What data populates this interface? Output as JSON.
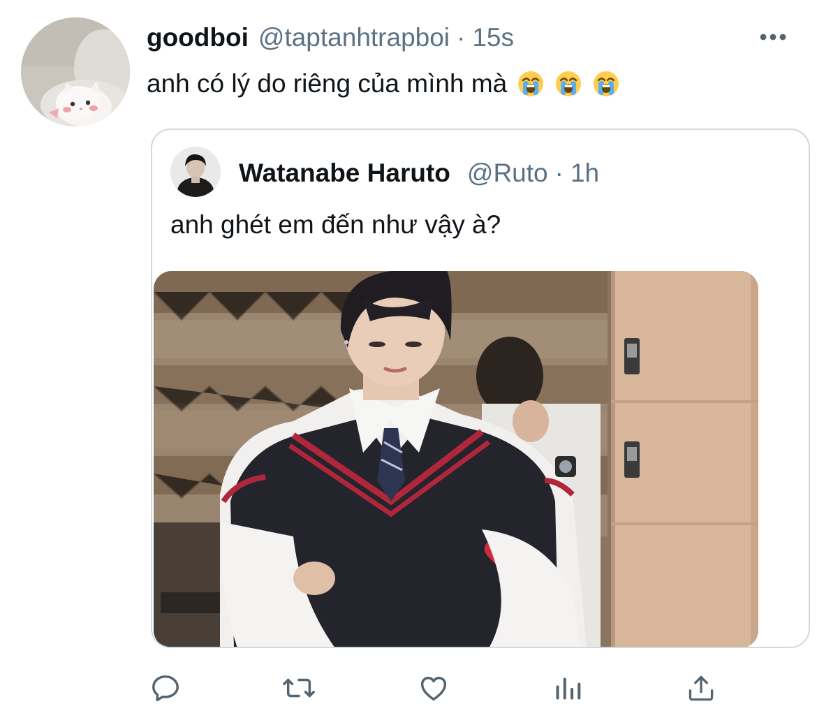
{
  "tweet": {
    "display_name": "goodboi",
    "handle": "@taptanhtrapboi",
    "separator": "·",
    "time": "15s",
    "text": "anh có lý do riêng của mình mà",
    "emojis": [
      "loudly-crying-face",
      "loudly-crying-face",
      "loudly-crying-face"
    ]
  },
  "quoted": {
    "display_name": "Watanabe Haruto",
    "handle": "@Ruto",
    "separator": "·",
    "time": "1h",
    "text": "anh ghét em đến như vậy à?"
  },
  "actions": [
    {
      "icon": "reply-icon"
    },
    {
      "icon": "retweet-icon"
    },
    {
      "icon": "like-icon"
    },
    {
      "icon": "analytics-icon"
    },
    {
      "icon": "share-icon"
    }
  ],
  "colors": {
    "text_primary": "#0f1419",
    "text_secondary": "#5b7083",
    "border": "#cfd9de",
    "icon": "#536471"
  }
}
